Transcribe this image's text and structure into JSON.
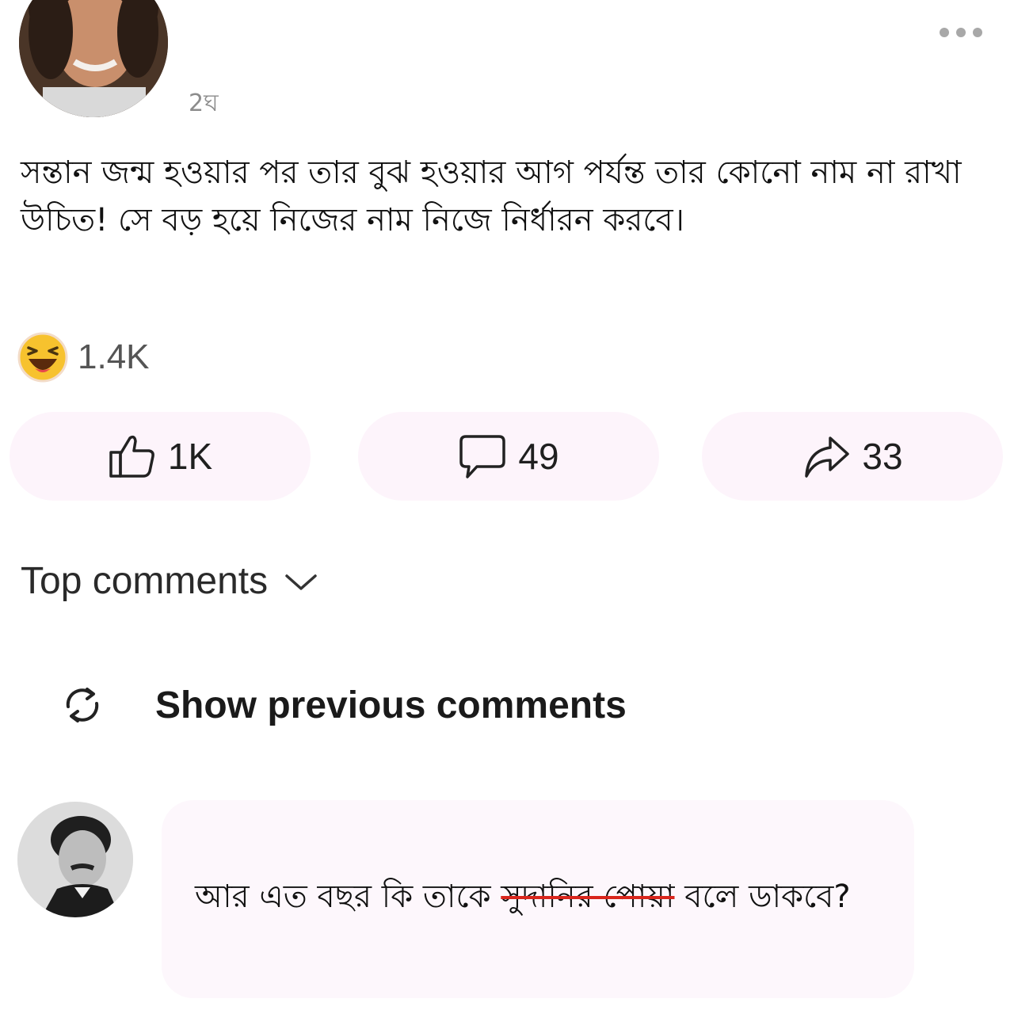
{
  "post": {
    "time": "2ঘ",
    "text": "সন্তান জন্ম হওয়ার পর তার বুঝ হওয়ার আগ পর্যন্ত তার কোনো নাম না রাখা উচিত! সে বড় হয়ে নিজের নাম নিজে নির্ধারন করবে।",
    "reaction_icon": "haha-emoji",
    "reaction_count": "1.4K"
  },
  "actions": {
    "like_count": "1K",
    "comment_count": "49",
    "share_count": "33"
  },
  "comments": {
    "sort_label": "Top comments",
    "show_previous_label": "Show previous comments",
    "first": {
      "text_before": "আর এত বছর কি তাকে ",
      "text_struck": "সুদানির পোয়া",
      "text_after": " বলে ডাকবে?"
    }
  },
  "colors": {
    "pill_background": "#fdf4fb",
    "strike_color": "#d9251c",
    "haha_yellow": "#f7c22e"
  }
}
